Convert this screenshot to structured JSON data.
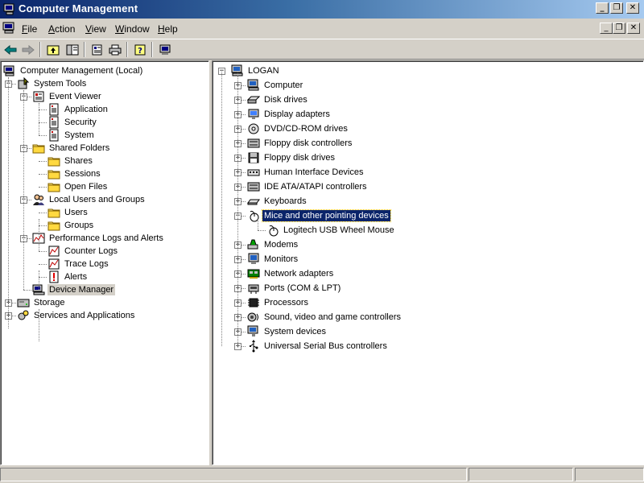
{
  "window": {
    "title": "Computer Management"
  },
  "menu": [
    {
      "label_u": "F",
      "label_rest": "ile"
    },
    {
      "label_u": "A",
      "label_rest": "ction"
    },
    {
      "label_u": "V",
      "label_rest": "iew"
    },
    {
      "label_u": "W",
      "label_rest": "indow"
    },
    {
      "label_u": "H",
      "label_rest": "elp"
    }
  ],
  "left_tree": [
    {
      "label": "Computer Management (Local)",
      "icon": "computer-management-icon"
    },
    {
      "label": "System Tools",
      "icon": "system-tools-icon"
    },
    {
      "label": "Event Viewer",
      "icon": "event-viewer-icon"
    },
    {
      "label": "Application",
      "icon": "log-icon"
    },
    {
      "label": "Security",
      "icon": "log-icon"
    },
    {
      "label": "System",
      "icon": "log-icon"
    },
    {
      "label": "Shared Folders",
      "icon": "folder-icon"
    },
    {
      "label": "Shares",
      "icon": "folder-icon"
    },
    {
      "label": "Sessions",
      "icon": "folder-icon"
    },
    {
      "label": "Open Files",
      "icon": "folder-icon"
    },
    {
      "label": "Local Users and Groups",
      "icon": "users-icon"
    },
    {
      "label": "Users",
      "icon": "folder-icon"
    },
    {
      "label": "Groups",
      "icon": "folder-icon"
    },
    {
      "label": "Performance Logs and Alerts",
      "icon": "performance-icon"
    },
    {
      "label": "Counter Logs",
      "icon": "chart-icon"
    },
    {
      "label": "Trace Logs",
      "icon": "chart-icon"
    },
    {
      "label": "Alerts",
      "icon": "alert-icon"
    },
    {
      "label": "Device Manager",
      "icon": "device-manager-icon"
    },
    {
      "label": "Storage",
      "icon": "storage-icon"
    },
    {
      "label": "Services and Applications",
      "icon": "services-icon"
    }
  ],
  "right_tree": [
    {
      "label": "LOGAN",
      "icon": "computer-icon"
    },
    {
      "label": "Computer",
      "icon": "computer-icon"
    },
    {
      "label": "Disk drives",
      "icon": "disk-drive-icon"
    },
    {
      "label": "Display adapters",
      "icon": "display-icon"
    },
    {
      "label": "DVD/CD-ROM drives",
      "icon": "cdrom-icon"
    },
    {
      "label": "Floppy disk controllers",
      "icon": "controller-icon"
    },
    {
      "label": "Floppy disk drives",
      "icon": "floppy-icon"
    },
    {
      "label": "Human Interface Devices",
      "icon": "hid-icon"
    },
    {
      "label": "IDE ATA/ATAPI controllers",
      "icon": "controller-icon"
    },
    {
      "label": "Keyboards",
      "icon": "keyboard-icon"
    },
    {
      "label": "Mice and other pointing devices",
      "icon": "mouse-icon"
    },
    {
      "label": "Logitech USB Wheel Mouse",
      "icon": "mouse-icon"
    },
    {
      "label": "Modems",
      "icon": "modem-icon"
    },
    {
      "label": "Monitors",
      "icon": "monitor-icon"
    },
    {
      "label": "Network adapters",
      "icon": "network-icon"
    },
    {
      "label": "Ports (COM & LPT)",
      "icon": "port-icon"
    },
    {
      "label": "Processors",
      "icon": "processor-icon"
    },
    {
      "label": "Sound, video and game controllers",
      "icon": "sound-icon"
    },
    {
      "label": "System devices",
      "icon": "system-device-icon"
    },
    {
      "label": "Universal Serial Bus controllers",
      "icon": "usb-icon"
    }
  ]
}
